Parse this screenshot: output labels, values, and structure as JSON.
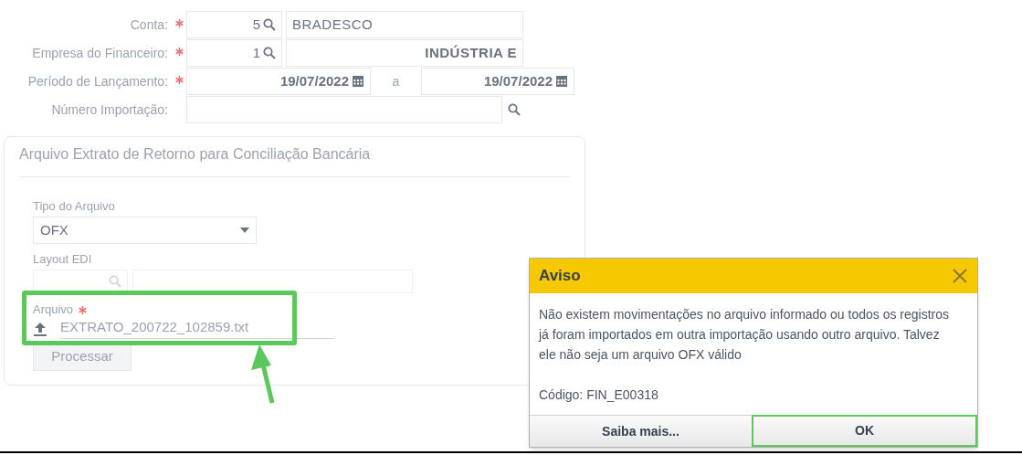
{
  "form": {
    "rows": [
      {
        "kind": "lookup",
        "label": "Conta:",
        "required": true,
        "code": "5",
        "description": "BRADESCO"
      },
      {
        "kind": "lookup",
        "label": "Empresa do Financeiro:",
        "required": true,
        "code": "1",
        "description": "INDÚSTRIA E"
      },
      {
        "kind": "period",
        "label": "Período de Lançamento:",
        "required": true,
        "from": "19/07/2022",
        "separator": "a",
        "to": "19/07/2022"
      },
      {
        "kind": "search",
        "label": "Número Importação:",
        "required": false
      }
    ]
  },
  "panel": {
    "title": "Arquivo Extrato de Retorno para Conciliação Bancária",
    "file_type": {
      "label": "Tipo do Arquivo",
      "value": "OFX"
    },
    "layout_edi": {
      "label": "Layout EDI"
    },
    "file": {
      "label": "Arquivo",
      "required": true,
      "value": "EXTRATO_200722_102859.txt"
    },
    "button": "Processar"
  },
  "dialog": {
    "title": "Aviso",
    "message": "Não existem movimentações no arquivo informado ou todos os registros já foram importados em outra importação usando outro arquivo. Talvez ele não seja um arquivo OFX válido",
    "code": "Código: FIN_E00318",
    "buttons": [
      {
        "label": "Saiba mais...",
        "selected": false
      },
      {
        "label": "OK",
        "selected": true
      }
    ]
  }
}
